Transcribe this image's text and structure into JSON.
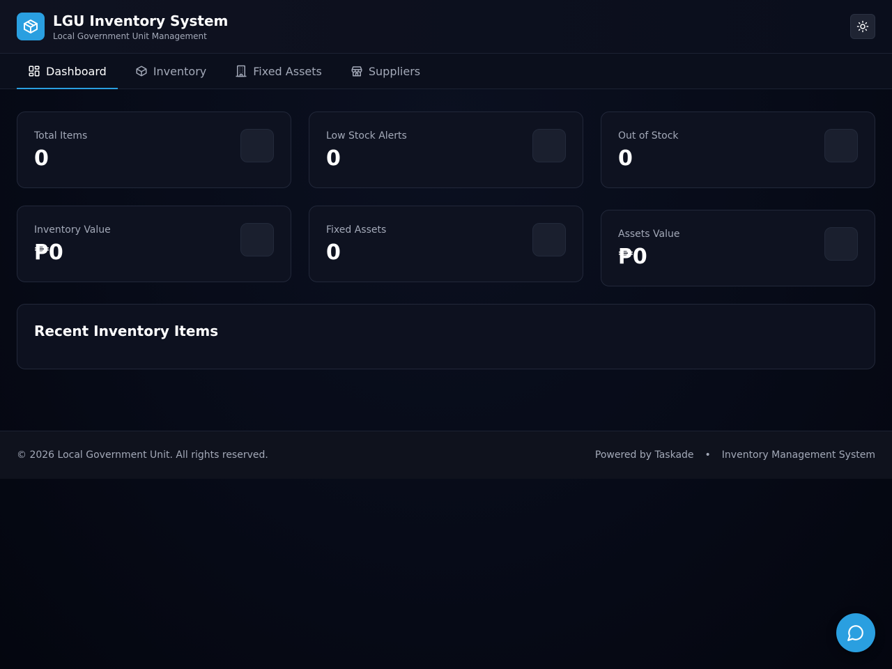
{
  "header": {
    "title": "LGU Inventory System",
    "subtitle": "Local Government Unit Management",
    "logo_icon": "box-icon",
    "theme_icon": "sun-icon"
  },
  "nav": {
    "tabs": [
      {
        "label": "Dashboard",
        "icon": "dashboard-icon",
        "active": true
      },
      {
        "label": "Inventory",
        "icon": "box-icon",
        "active": false
      },
      {
        "label": "Fixed Assets",
        "icon": "building-icon",
        "active": false
      },
      {
        "label": "Suppliers",
        "icon": "store-icon",
        "active": false
      }
    ]
  },
  "stats": [
    {
      "label": "Total Items",
      "value": "0"
    },
    {
      "label": "Low Stock Alerts",
      "value": "0"
    },
    {
      "label": "Out of Stock",
      "value": "0"
    },
    {
      "label": "Inventory Value",
      "value": "₱0"
    },
    {
      "label": "Fixed Assets",
      "value": "0"
    },
    {
      "label": "Assets Value",
      "value": "₱0"
    }
  ],
  "recent": {
    "title": "Recent Inventory Items"
  },
  "footer": {
    "copyright": "© 2026 Local Government Unit. All rights reserved.",
    "powered_by": "Powered by Taskade",
    "separator": "•",
    "system_name": "Inventory Management System"
  },
  "colors": {
    "accent": "#2a9fe0",
    "background": "#070b17",
    "card": "#0e1220"
  }
}
